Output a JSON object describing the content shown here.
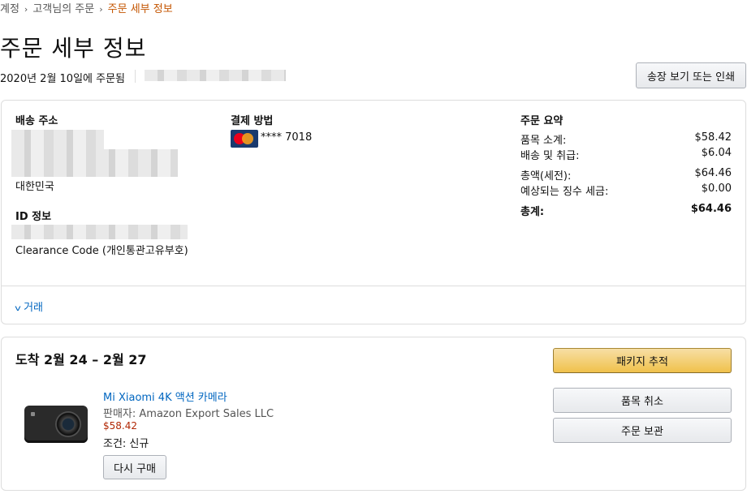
{
  "breadcrumb": {
    "items": [
      "계정",
      "고객님의 주문"
    ],
    "current": "주문 세부 정보",
    "separator": "›"
  },
  "page_title": "주문 세부 정보",
  "order_meta": {
    "ordered_date": "2020년 2월 10일에 주문됨"
  },
  "invoice_button": "송장 보기 또는 인쇄",
  "shipping": {
    "heading": "배송 주소",
    "country": "대한민국"
  },
  "id_info": {
    "heading": "ID 정보",
    "clearance": "Clearance Code (개인통관고유부호)"
  },
  "payment": {
    "heading": "결제 방법",
    "card_masked": "**** 7018",
    "card_icon": "mastercard-icon"
  },
  "summary": {
    "heading": "주문 요약",
    "rows": [
      {
        "label": "품목 소계:",
        "value": "$58.42"
      },
      {
        "label": "배송 및 취급:",
        "value": "$6.04"
      },
      {
        "label": "총액(세전):",
        "value": "$64.46"
      },
      {
        "label": "예상되는 징수 세금:",
        "value": "$0.00"
      }
    ],
    "total_label": "총계:",
    "total_value": "$64.46"
  },
  "transactions": {
    "label": "거래",
    "chevron": "chevron-down-icon"
  },
  "delivery": {
    "title": "도착 2월 24 – 2월 27",
    "product_name": "Mi Xiaomi 4K 액션 카메라",
    "seller": "판매자: Amazon Export Sales LLC",
    "price": "$58.42",
    "condition": "조건: 신규",
    "buy_again": "다시 구매",
    "track_button": "패키지 추적",
    "cancel_button": "품목 취소",
    "archive_button": "주문 보관"
  },
  "colors": {
    "link": "#0066c0",
    "price": "#b12704",
    "breadcrumb_current": "#c45500",
    "primary_button": "#f0c14b"
  }
}
